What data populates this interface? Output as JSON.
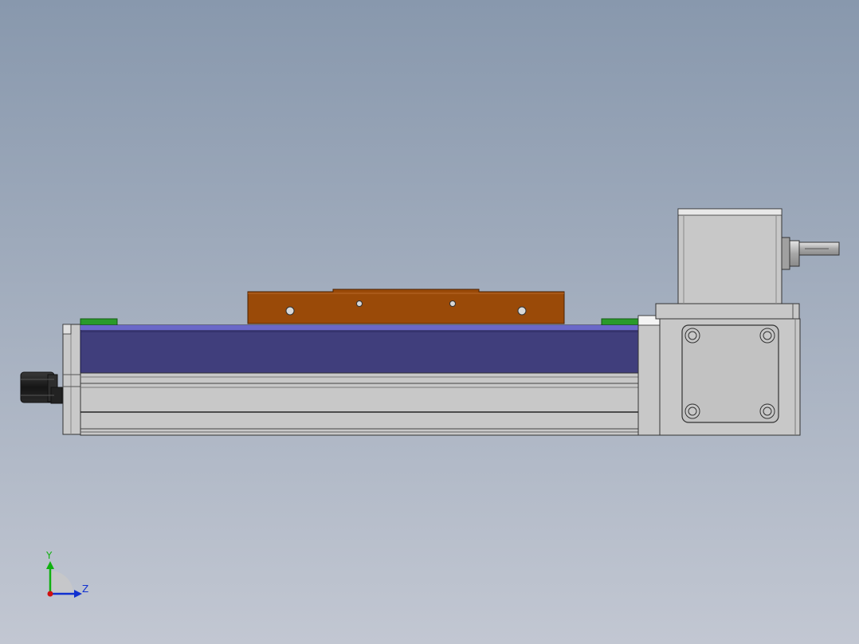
{
  "viewport": {
    "background_top": "#8898ad",
    "background_bottom": "#c2c7d2"
  },
  "model": {
    "components": [
      "servo-motor",
      "motor-flange",
      "actuator-body",
      "carriage-cover",
      "slider-plate",
      "end-sensors",
      "gearbox",
      "output-shaft"
    ],
    "colors": {
      "cover": "#403e7c",
      "cover_edge": "#6a68c8",
      "slider": "#9a4a08",
      "sensor": "#2a9a2a",
      "housing": "#c8c8c8",
      "motor": "#1e1e1e"
    }
  },
  "triad": {
    "y_label": "Y",
    "z_label": "Z",
    "y_color": "#10b010",
    "z_color": "#1030d0",
    "x_color": "#d01010"
  }
}
